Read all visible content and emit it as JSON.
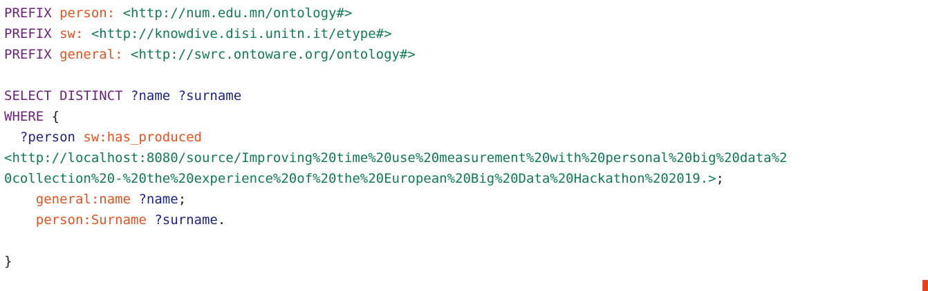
{
  "editor": {
    "lines": [
      [
        {
          "cls": "kw",
          "t": "PREFIX "
        },
        {
          "cls": "pf",
          "t": "person: "
        },
        {
          "cls": "iri",
          "t": "<http://num.edu.mn/ontology#>"
        }
      ],
      [
        {
          "cls": "kw",
          "t": "PREFIX "
        },
        {
          "cls": "pf",
          "t": "sw: "
        },
        {
          "cls": "iri",
          "t": "<http://knowdive.disi.unitn.it/etype#>"
        }
      ],
      [
        {
          "cls": "kw",
          "t": "PREFIX "
        },
        {
          "cls": "pf",
          "t": "general: "
        },
        {
          "cls": "iri",
          "t": "<http://swrc.ontoware.org/ontology#>"
        }
      ],
      [],
      [
        {
          "cls": "kw",
          "t": "SELECT DISTINCT "
        },
        {
          "cls": "var",
          "t": "?name ?surname"
        }
      ],
      [
        {
          "cls": "kw",
          "t": "WHERE "
        },
        {
          "cls": "punct",
          "t": "{"
        }
      ],
      [
        {
          "cls": "punct",
          "t": "  "
        },
        {
          "cls": "var",
          "t": "?person "
        },
        {
          "cls": "pf",
          "t": "sw:has_produced"
        }
      ],
      [
        {
          "cls": "iri",
          "t": "<http://localhost:8080/source/Improving%20time%20use%20measurement%20with%20personal%20big%20data%2"
        }
      ],
      [
        {
          "cls": "iri",
          "t": "0collection%20-%20the%20experience%20of%20the%20European%20Big%20Data%20Hackathon%202019.>"
        },
        {
          "cls": "punct",
          "t": ";"
        }
      ],
      [
        {
          "cls": "punct",
          "t": "    "
        },
        {
          "cls": "pf",
          "t": "general:name "
        },
        {
          "cls": "var",
          "t": "?name"
        },
        {
          "cls": "punct",
          "t": ";"
        }
      ],
      [
        {
          "cls": "punct",
          "t": "    "
        },
        {
          "cls": "pf",
          "t": "person:Surname "
        },
        {
          "cls": "var",
          "t": "?surname"
        },
        {
          "cls": "punct",
          "t": "."
        }
      ],
      [],
      [
        {
          "cls": "punct",
          "t": "}"
        }
      ]
    ]
  },
  "colors": {
    "keyword": "#6b1f7a",
    "prefix": "#e8501e",
    "iri": "#0e7a54",
    "variable": "#1a1f8c",
    "cursor": "#e8401c"
  }
}
